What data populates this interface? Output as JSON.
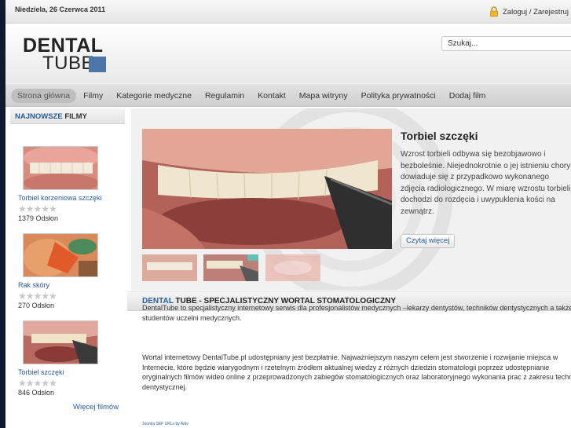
{
  "topbar": {
    "date": "Niedziela, 26 Czerwca 2011",
    "login_text": "Zaloguj / Zarejestruj się"
  },
  "header": {
    "logo_line1": "DENTAL",
    "logo_line2": "TUBE",
    "search_placeholder": "Szukaj..."
  },
  "nav": {
    "items": [
      {
        "label": "Strona główna",
        "active": true
      },
      {
        "label": "Filmy"
      },
      {
        "label": "Kategorie medyczne"
      },
      {
        "label": "Regulamin"
      },
      {
        "label": "Kontakt"
      },
      {
        "label": "Mapa witryny"
      },
      {
        "label": "Polityka prywatności"
      },
      {
        "label": "Dodaj film"
      }
    ]
  },
  "sidebar": {
    "title_accent": "NAJNOWSZE",
    "title_rest": "FILMY",
    "videos": [
      {
        "title": "Torbiel korzeniowa szczęki",
        "rating": 0,
        "views": "1379 Odsłon"
      },
      {
        "title": "Rak skóry",
        "rating": 0,
        "views": "270 Odsłon"
      },
      {
        "title": "Torbiel szczęki",
        "rating": 0,
        "views": "846 Odsłon"
      }
    ],
    "more_link": "Więcej filmów"
  },
  "feature": {
    "title": "Torbiel szczęki",
    "text": "Wzrost torbieli odbywa się bezobjawowo i bezboleśnie. Niejednokrotnie o jej istnieniu chory dowiaduje się z przypadkowo wykonanego zdjęcia radiologicznego. W miarę wzrostu torbieli dochodzi do rozdęcia i uwypuklenia kości na zewnątrz.",
    "button": "Czytaj więcej"
  },
  "section": {
    "title_accent": "DENTAL",
    "title_rest": "TUBE - SPECJALISTYCZNY WORTAL STOMATOLOGICZNY",
    "paragraph1": "DentalTube to specjalistyczny internetowy serwis dla profesjonalistów medycznych –lekarzy dentystów, techników dentystycznych a także studentów uczelni medycznych.",
    "paragraph2": "Wortal internetowy DentalTube.pl udostępniany jest bezpłatnie. Najważniejszym naszym celem jest stworzenie i rozwijanie miejsca w Internecie, które będzie wiarygodnym i rzetelnym źródłem aktualnej wiedzy z różnych dziedzin stomatologii poprzez udostępnianie oryginalnych filmów wideo online z przeprowadzonych zabiegów stomatologicznych oraz laboratoryjnego wykonania prac z zakresu techniki dentystycznej."
  },
  "footer": {
    "link": "Joomla SEF URLs by Artio"
  },
  "colors": {
    "accent": "#2a5c9a",
    "logo_square": "#4a76a8",
    "background": "#0d1a2e"
  }
}
